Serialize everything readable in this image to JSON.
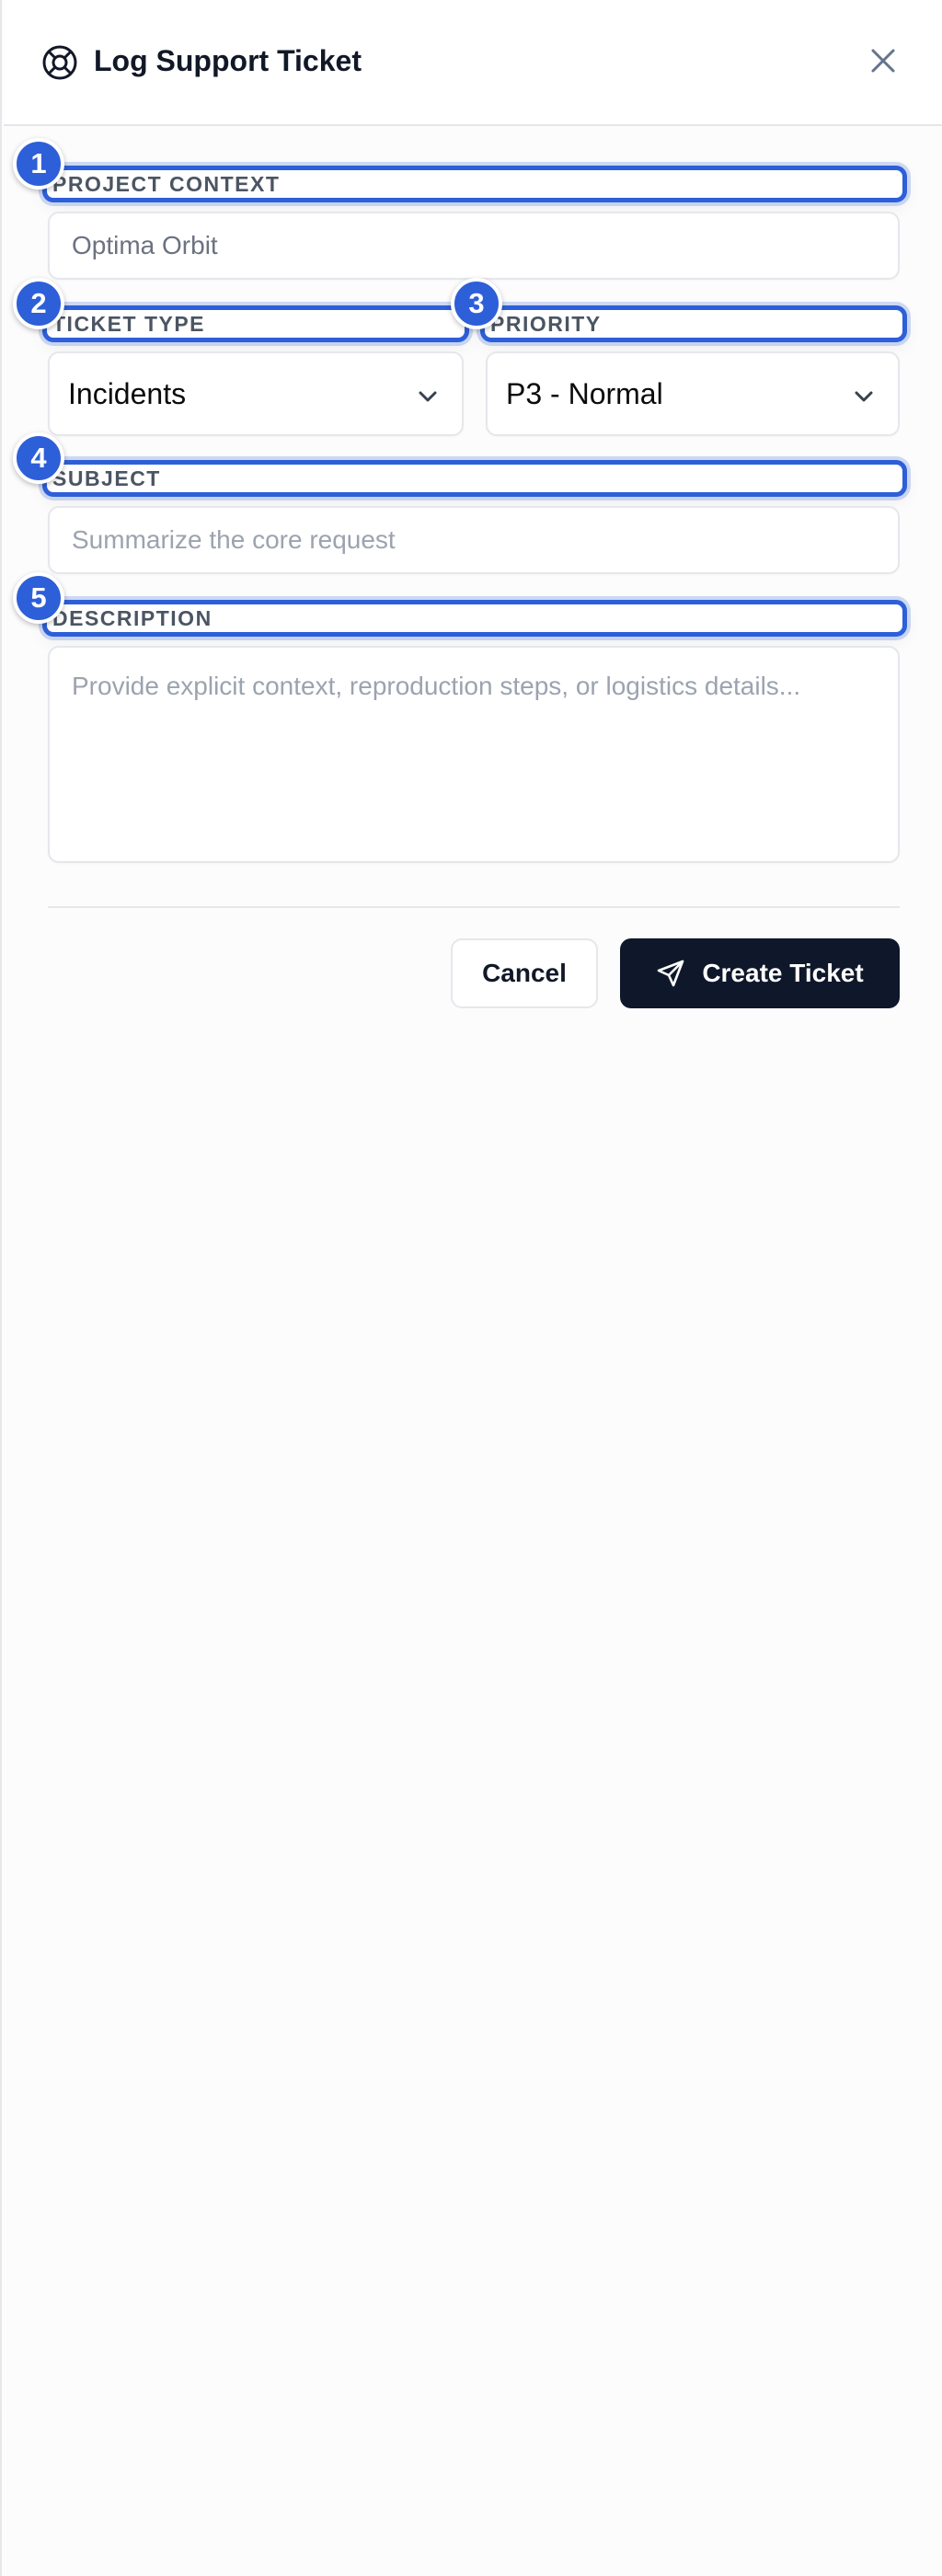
{
  "header": {
    "title": "Log Support Ticket",
    "icon": "lifebuoy-icon",
    "close_icon": "close-icon"
  },
  "fields": {
    "project_context": {
      "badge": "1",
      "label": "PROJECT CONTEXT",
      "value": "Optima Orbit"
    },
    "ticket_type": {
      "badge": "2",
      "label": "TICKET TYPE",
      "value": "Incidents"
    },
    "priority": {
      "badge": "3",
      "label": "PRIORITY",
      "value": "P3 - Normal"
    },
    "subject": {
      "badge": "4",
      "label": "SUBJECT",
      "placeholder": "Summarize the core request"
    },
    "description": {
      "badge": "5",
      "label": "DESCRIPTION",
      "placeholder": "Provide explicit context, reproduction steps, or logistics details..."
    }
  },
  "actions": {
    "cancel_label": "Cancel",
    "create_label": "Create Ticket",
    "create_icon": "send-icon"
  },
  "colors": {
    "accent": "#2d5fd9",
    "primary_button": "#0f172a"
  }
}
